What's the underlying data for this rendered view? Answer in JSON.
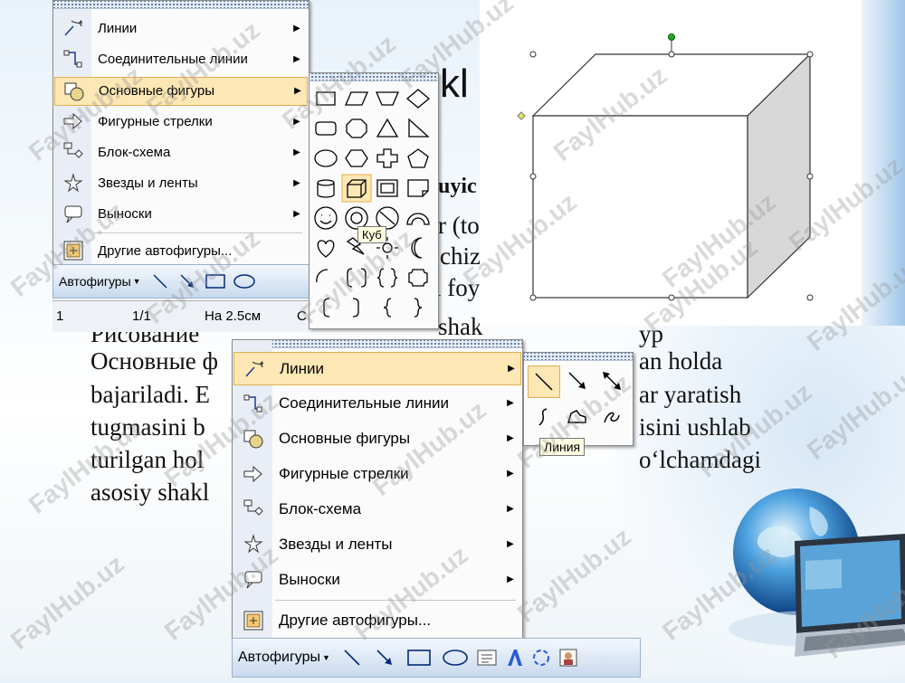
{
  "slide": {
    "title_fragment": "kl",
    "heading_fragment": "uyic",
    "line_r1": "r (to",
    "line_r2": "chiz",
    "line_r3": "l foy",
    "line1": "Рисование",
    "line1b": "shak",
    "line1c": "yp",
    "line2": "Основные ф",
    "line2b": "an holda",
    "line3": "bajariladi. E",
    "line3b": "ar yaratish",
    "line4": "tugmasini b",
    "line4b": "isini ushlab",
    "line5": "turilgan hol",
    "line5b": "o‘lchamdagi",
    "line6": "asosiy shakl"
  },
  "watermark": "FaylHub.uz",
  "menu_top": {
    "items": [
      {
        "label": "Линии",
        "icon": "lines-icon"
      },
      {
        "label": "Соединительные линии",
        "icon": "connectors-icon"
      },
      {
        "label": "Основные фигуры",
        "icon": "basic-shapes-icon",
        "highlighted": true
      },
      {
        "label": "Фигурные стрелки",
        "icon": "block-arrows-icon"
      },
      {
        "label": "Блок-схема",
        "icon": "flowchart-icon"
      },
      {
        "label": "Звезды и ленты",
        "icon": "stars-banners-icon"
      },
      {
        "label": "Выноски",
        "icon": "callouts-icon"
      },
      {
        "label": "Другие автофигуры...",
        "icon": "more-autoshapes-icon"
      }
    ],
    "toolbar_label": "Автофигуры",
    "status": {
      "col": "1",
      "page": "1/1",
      "position": "На 2.5см",
      "extra": "С"
    }
  },
  "shapes_palette": {
    "tooltip": "Куб"
  },
  "menu_bottom": {
    "items": [
      {
        "label": "Линии",
        "icon": "lines-icon",
        "highlighted": true
      },
      {
        "label": "Соединительные линии",
        "icon": "connectors-icon"
      },
      {
        "label": "Основные фигуры",
        "icon": "basic-shapes-icon"
      },
      {
        "label": "Фигурные стрелки",
        "icon": "block-arrows-icon"
      },
      {
        "label": "Блок-схема",
        "icon": "flowchart-icon"
      },
      {
        "label": "Звезды и ленты",
        "icon": "stars-banners-icon"
      },
      {
        "label": "Выноски",
        "icon": "callouts-icon"
      },
      {
        "label": "Другие автофигуры...",
        "icon": "more-autoshapes-icon"
      }
    ],
    "toolbar_label": "Автофигуры"
  },
  "lines_palette": {
    "tooltip": "Линия"
  },
  "colors": {
    "highlight": "#fde7b4",
    "highlight_border": "#e2ae52",
    "toolbar": "#c8d9ee",
    "handle_green": "#22aa22"
  }
}
